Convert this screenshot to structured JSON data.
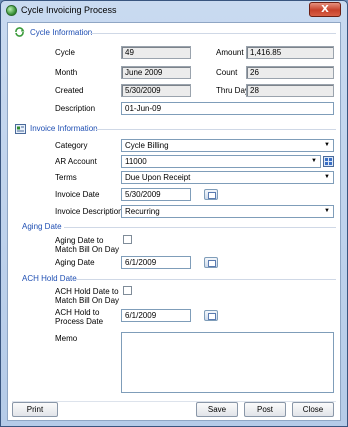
{
  "window": {
    "title": "Cycle Invoicing Process",
    "close_glyph": "X"
  },
  "cycle_info": {
    "heading": "Cycle Information",
    "cycle_label": "Cycle",
    "cycle_value": "49",
    "amount_label": "Amount",
    "amount_value": "1,416.85",
    "month_label": "Month",
    "month_value": "June 2009",
    "count_label": "Count",
    "count_value": "26",
    "created_label": "Created",
    "created_value": "5/30/2009",
    "thru_day_label": "Thru Day",
    "thru_day_value": "28",
    "description_label": "Description",
    "description_value": "01-Jun-09"
  },
  "invoice_info": {
    "heading": "Invoice Information",
    "category_label": "Category",
    "category_value": "Cycle Billing",
    "ar_account_label": "AR Account",
    "ar_account_value": "11000",
    "terms_label": "Terms",
    "terms_value": "Due Upon Receipt",
    "invoice_date_label": "Invoice Date",
    "invoice_date_value": "5/30/2009",
    "invoice_description_label": "Invoice Description",
    "invoice_description_value": "Recurring"
  },
  "aging_date": {
    "heading": "Aging Date",
    "match_label_line1": "Aging Date to",
    "match_label_line2": "Match Bill On Day",
    "match_checked": false,
    "date_label": "Aging Date",
    "date_value": "6/1/2009"
  },
  "ach_hold_date": {
    "heading": "ACH Hold Date",
    "match_label_line1": "ACH Hold Date to",
    "match_label_line2": "Match Bill On Day",
    "match_checked": false,
    "process_label_line1": "ACH Hold to",
    "process_label_line2": "Process Date",
    "process_value": "6/1/2009"
  },
  "memo": {
    "label": "Memo",
    "value": ""
  },
  "buttons": {
    "print": "Print",
    "save": "Save",
    "post": "Post",
    "close": "Close"
  },
  "colors": {
    "section_heading": "#1f4fb3",
    "window_frame": "#b5cbe8",
    "close_button": "#c7412a"
  },
  "icons": {
    "window": "process-icon",
    "cycle_section": "cycle-icon",
    "invoice_section": "invoice-icon",
    "ar_lookup": "lookup-icon",
    "calendar": "calendar-icon"
  }
}
